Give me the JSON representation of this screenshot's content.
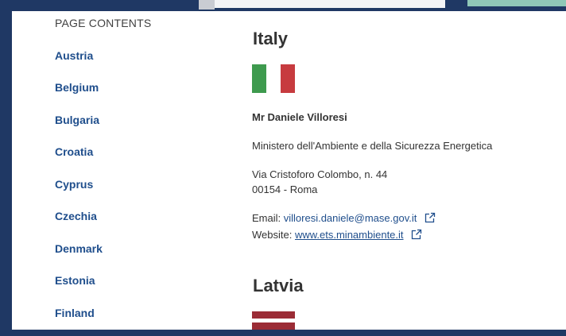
{
  "colors": {
    "frame": "#1f3864",
    "link": "#1f4e8c",
    "text": "#333333",
    "italy_green": "#3e9a4e",
    "italy_white": "#ffffff",
    "italy_red": "#c73b3f",
    "latvia_red": "#9b2c36",
    "latvia_white": "#ffffff"
  },
  "sidebar": {
    "title": "PAGE CONTENTS",
    "items": [
      {
        "label": "Austria"
      },
      {
        "label": "Belgium"
      },
      {
        "label": "Bulgaria"
      },
      {
        "label": "Croatia"
      },
      {
        "label": "Cyprus"
      },
      {
        "label": "Czechia"
      },
      {
        "label": "Denmark"
      },
      {
        "label": "Estonia"
      },
      {
        "label": "Finland"
      }
    ]
  },
  "main": {
    "italy": {
      "heading": "Italy",
      "flag_icon": "italy-flag-icon",
      "contact_name": "Mr Daniele Villoresi",
      "organization": "Ministero dell'Ambiente e della Sicurezza Energetica",
      "address_line1": "Via Cristoforo Colombo, n. 44",
      "address_line2": "00154 - Roma",
      "email_label": "Email:",
      "email": "villoresi.daniele@mase.gov.it",
      "website_label": "Website:",
      "website": "www.ets.minambiente.it",
      "external_link_icon": "external-link-icon"
    },
    "latvia": {
      "heading": "Latvia",
      "flag_icon": "latvia-flag-icon"
    }
  }
}
